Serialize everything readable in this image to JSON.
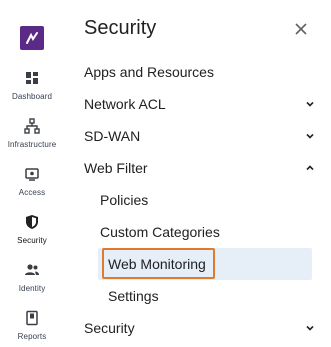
{
  "rail": {
    "items": [
      {
        "label": "Dashboard",
        "icon": "dashboard-icon"
      },
      {
        "label": "Infrastructure",
        "icon": "infrastructure-icon"
      },
      {
        "label": "Access",
        "icon": "access-icon"
      },
      {
        "label": "Security",
        "icon": "shield-icon",
        "active": true
      },
      {
        "label": "Identity",
        "icon": "users-icon"
      },
      {
        "label": "Reports",
        "icon": "reports-icon"
      }
    ]
  },
  "panel": {
    "title": "Security",
    "close_icon": "close-icon",
    "nav": [
      {
        "label": "Apps and Resources"
      },
      {
        "label": "Network ACL",
        "chevron": "down"
      },
      {
        "label": "SD-WAN",
        "chevron": "down"
      },
      {
        "label": "Web Filter",
        "chevron": "up"
      },
      {
        "label": "Security",
        "chevron": "down"
      }
    ],
    "web_filter_children": [
      {
        "label": "Policies"
      },
      {
        "label": "Custom Categories"
      },
      {
        "label": "Web Monitoring",
        "selected": true
      },
      {
        "label": "Settings"
      }
    ]
  },
  "colors": {
    "brand": "#5b2a86",
    "selected_bg": "#e6eef8",
    "focus_outline": "#e07a2e"
  }
}
